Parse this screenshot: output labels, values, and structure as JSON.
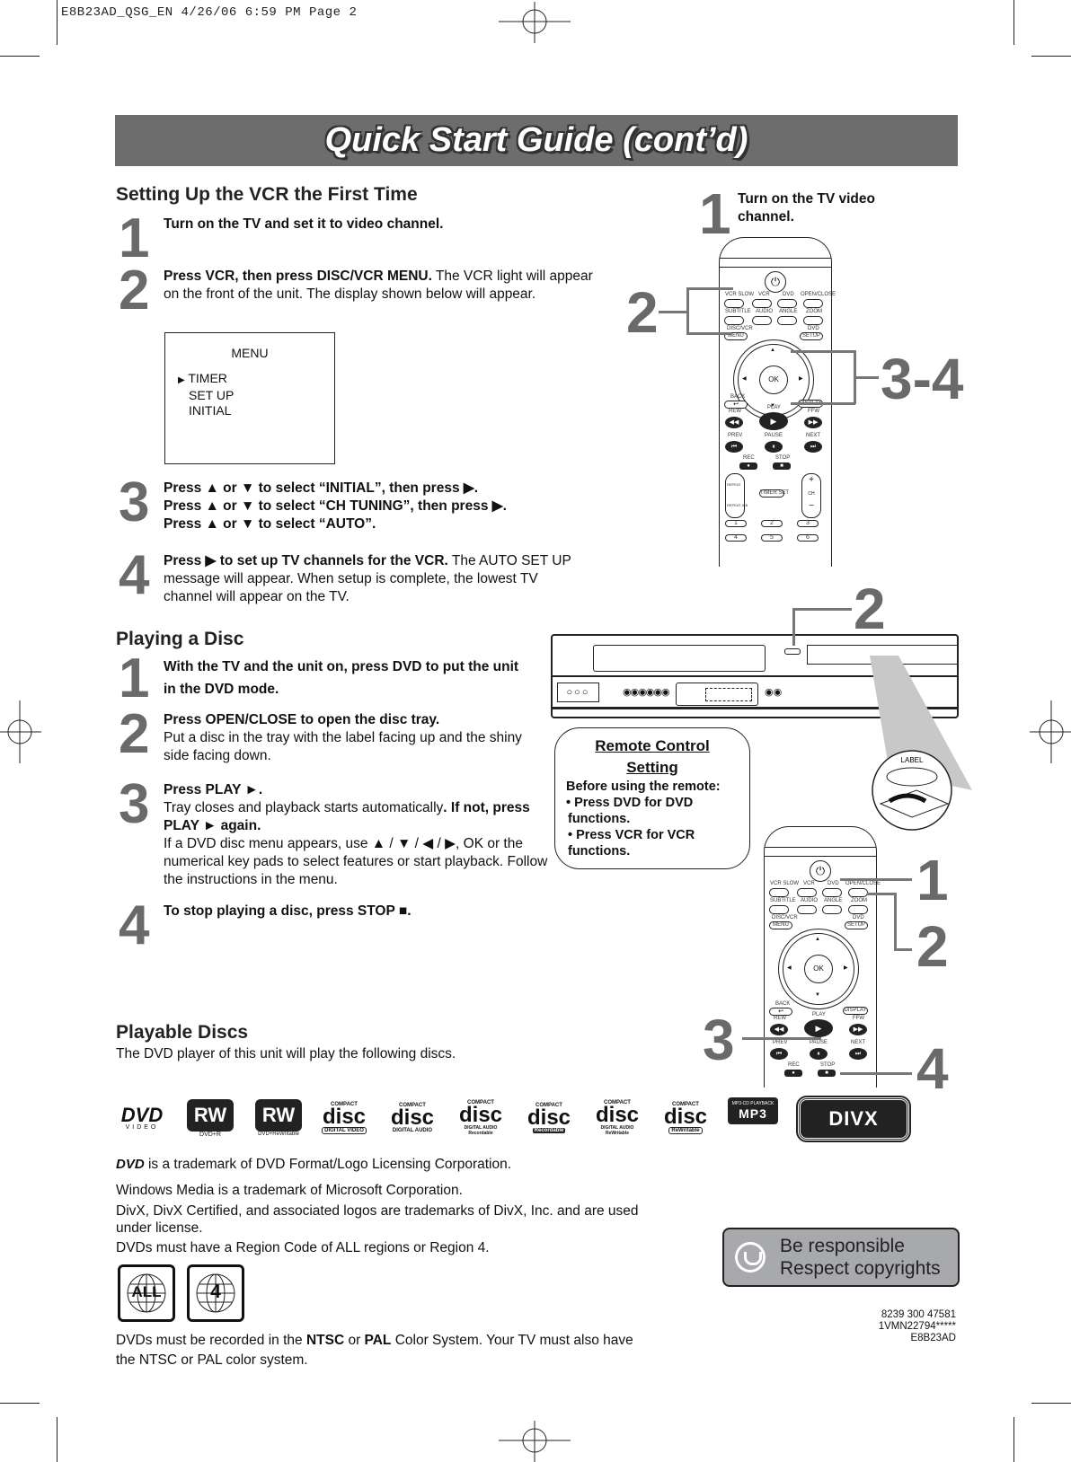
{
  "slug": "E8B23AD_QSG_EN  4/26/06  6:59 PM  Page 2",
  "banner_title": "Quick Start Guide (cont’d)",
  "vcr_setup": {
    "heading": "Setting Up the VCR the First Time",
    "steps": [
      {
        "num": "1",
        "bold": "Turn on the TV and set it to video channel.",
        "text": ""
      },
      {
        "num": "2",
        "bold": "Press VCR, then press DISC/VCR MENU.",
        "text": " The VCR light will appear on the front of the unit. The display shown below will appear."
      },
      {
        "num": "3",
        "lines": [
          "Press ▲ or ▼ to select “INITIAL”, then press ▶.",
          "Press ▲ or ▼ to select “CH TUNING”, then press ▶.",
          "Press ▲ or ▼ to select “AUTO”."
        ]
      },
      {
        "num": "4",
        "bold": "Press ▶ to set up TV channels for the VCR.",
        "text": " The AUTO SET UP message will appear. When setup is complete, the lowest TV channel will appear on the TV."
      }
    ],
    "menu_display": {
      "title": "MENU",
      "items": [
        "TIMER",
        "SET UP",
        "INITIAL"
      ],
      "cursor": "▶"
    }
  },
  "remote_top": {
    "step1_num": "1",
    "step1_text": "Turn on the TV video channel.",
    "callout_2": "2",
    "callout_34": "3-4"
  },
  "remote_labels": {
    "vcr_slow": "VCR SLOW",
    "vcr": "VCR",
    "dvd": "DVD",
    "open_close": "OPEN/CLOSE",
    "subtitle": "SUBTITLE",
    "audio": "AUDIO",
    "angle": "ANGLE",
    "zoom": "ZOOM",
    "disc_vcr": "DISC/VCR",
    "menu": "MENU",
    "dvd2": "DVD",
    "setup": "SETUP",
    "ok": "OK",
    "back": "BACK",
    "display": "DISPLAY",
    "rew": "REW",
    "play": "PLAY",
    "ffw": "FFW",
    "prev": "PREV",
    "pause": "PAUSE",
    "next": "NEXT",
    "rec": "REC",
    "stop": "STOP",
    "repeat": "REPEAT",
    "repeat_ab": "REPEAT A-B",
    "timer_set": "TIMER SET",
    "ch": "CH",
    "keys": [
      "1",
      "2",
      "3",
      "4",
      "5",
      "6"
    ]
  },
  "playing_disc": {
    "heading": "Playing a Disc",
    "steps": [
      {
        "num": "1",
        "bold": "With the TV and the unit on, press DVD to put the unit in the DVD mode.",
        "text": ""
      },
      {
        "num": "2",
        "bold": "Press OPEN/CLOSE to open the disc tray.",
        "text": "Put a disc in the tray with the label facing up and the shiny side facing down."
      },
      {
        "num": "3",
        "bold": "Press PLAY ►.",
        "text1": "Tray closes and playback starts automatically",
        "bold2": ". If not, press PLAY ► again.",
        "text2": "If a DVD disc menu appears, use ▲ / ▼ / ◀ / ▶, OK or the numerical key pads to select features or start playback. Follow the instructions in the menu."
      },
      {
        "num": "4",
        "bold": "To stop playing a disc, press STOP ■.",
        "text": ""
      }
    ]
  },
  "unit_callout": "2",
  "disc_label": "LABEL",
  "remote_control_setting": {
    "title_line1": "Remote Control",
    "title_line2": "Setting",
    "intro": "Before using the remote:",
    "bullets": [
      "• Press DVD for DVD functions.",
      "• Press VCR for VCR functions."
    ]
  },
  "remote_bottom_callouts": [
    "1",
    "2",
    "3",
    "4"
  ],
  "playable_discs": {
    "heading": "Playable Discs",
    "text": "The DVD player of this unit will play the following discs.",
    "logos": [
      {
        "name": "dvd-video",
        "main": "DVD",
        "sub": "VIDEO"
      },
      {
        "name": "dvd-plus-r",
        "main": "RW",
        "sub": "DVD+R"
      },
      {
        "name": "dvd-plus-rewritable",
        "main": "RW",
        "sub": "DVD+ReWritable"
      },
      {
        "name": "cd-digital-video",
        "top": "COMPACT",
        "main": "disc",
        "sub": "DIGITAL VIDEO"
      },
      {
        "name": "cd-digital-audio",
        "top": "COMPACT",
        "main": "disc",
        "sub": "DIGITAL AUDIO"
      },
      {
        "name": "cd-digital-audio-recordable",
        "top": "COMPACT",
        "main": "disc",
        "sub": "DIGITAL AUDIO Recordable"
      },
      {
        "name": "cd-recordable",
        "top": "COMPACT",
        "main": "disc",
        "sub": "Recordable"
      },
      {
        "name": "cd-digital-audio-rewritable",
        "top": "COMPACT",
        "main": "disc",
        "sub": "DIGITAL AUDIO ReWritable"
      },
      {
        "name": "cd-rewritable",
        "top": "COMPACT",
        "main": "disc",
        "sub": "ReWritable"
      },
      {
        "name": "mp3",
        "top": "MP3-CD PLAYBACK",
        "main": "MP3",
        "sub": ""
      },
      {
        "name": "divx",
        "main": "DIVX",
        "sub": ""
      }
    ]
  },
  "trademarks": {
    "dvd_logo": "DVD",
    "dvd": "is a trademark of DVD Format/Logo Licensing Corporation.",
    "windows": "Windows Media is a trademark of Microsoft Corporation.",
    "divx": "DivX, DivX Certified, and associated logos are trademarks of DivX, Inc. and are used under license.",
    "region": "DVDs must have a Region Code of ALL regions or Region 4."
  },
  "regions": [
    "ALL",
    "4"
  ],
  "color_system": {
    "pre": "DVDs must be recorded in the ",
    "ntsc": "NTSC",
    "mid": " or ",
    "pal": "PAL",
    "post": " Color System. Your TV must also have the NTSC or PAL color system."
  },
  "responsible": {
    "line1": "Be responsible",
    "line2": "Respect copyrights"
  },
  "codes": [
    "8239 300 47581",
    "1VMN22794*****",
    "E8B23AD"
  ],
  "colors": {
    "banner": "#6d6d6d",
    "step_number": "#6a6a6a",
    "responsible_bg": "#a8a9ac"
  }
}
